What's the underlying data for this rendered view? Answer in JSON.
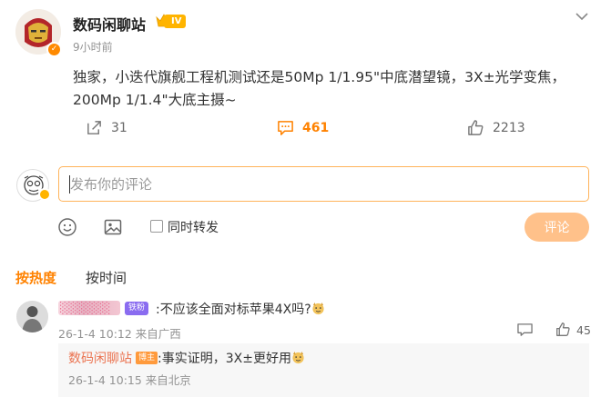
{
  "post": {
    "author": "数码闲聊站",
    "level": "IV",
    "time": "9小时前",
    "lines": [
      "独家，小迭代旗舰工程机测试还是50Mp 1/1.95\"中底潜望镜，3X±光学变焦，",
      "200Mp 1/1.4\"大底主摄~"
    ],
    "reposts": "31",
    "comments": "461",
    "likes": "2213"
  },
  "compose": {
    "placeholder": "发布你的评论",
    "forward_label": "同时转发",
    "submit_label": "评论"
  },
  "sort": {
    "hot": "按热度",
    "time": "按时间"
  },
  "comments": [
    {
      "user": "░░░░░░",
      "medal": "铁粉",
      "text": ":不应该全面对标苹果4X吗?",
      "meta": "26-1-4 10:12 来自广西",
      "likes": "45",
      "reply": {
        "user": "数码闲聊站",
        "badge": "博主",
        "text": ":事实证明，3X±更好用",
        "meta": "26-1-4 10:15 来自北京"
      }
    }
  ],
  "colors": {
    "accent": "#ff8200",
    "reply_name": "#eb7350",
    "muted": "#939393",
    "submit_bg": "#ffc18a",
    "input_border": "#ffb35a"
  },
  "icons": {
    "repost": "repost-icon",
    "comment": "comment-icon",
    "like": "like-icon",
    "emoji": "emoji-icon",
    "image": "image-icon",
    "menu": "chevron-down-icon"
  }
}
